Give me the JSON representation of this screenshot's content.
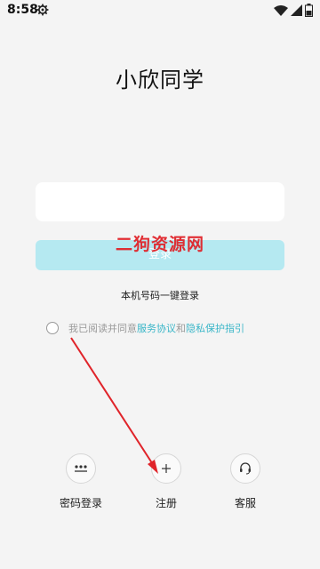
{
  "status_bar": {
    "time": "8:58",
    "icons": [
      "settings-gear-icon",
      "wifi-icon",
      "signal-icon",
      "battery-icon"
    ]
  },
  "app": {
    "title": "小欣同学"
  },
  "phone_input": {
    "value": "",
    "placeholder": ""
  },
  "login_button": {
    "label": "登录",
    "color": "#b5e9f1"
  },
  "watermark": "二狗资源网",
  "one_tap_login": "本机号码一键登录",
  "agreement": {
    "prefix": "我已阅读并同意",
    "link1": "服务协议",
    "connector": "和",
    "link2": "隐私保护指引",
    "link_color": "#3ab6c8"
  },
  "bottom_actions": [
    {
      "label": "密码登录",
      "icon": "password-dots-icon"
    },
    {
      "label": "注册",
      "icon": "plus-icon"
    },
    {
      "label": "客服",
      "icon": "headset-icon"
    }
  ],
  "annotation_color": "#e0242a"
}
